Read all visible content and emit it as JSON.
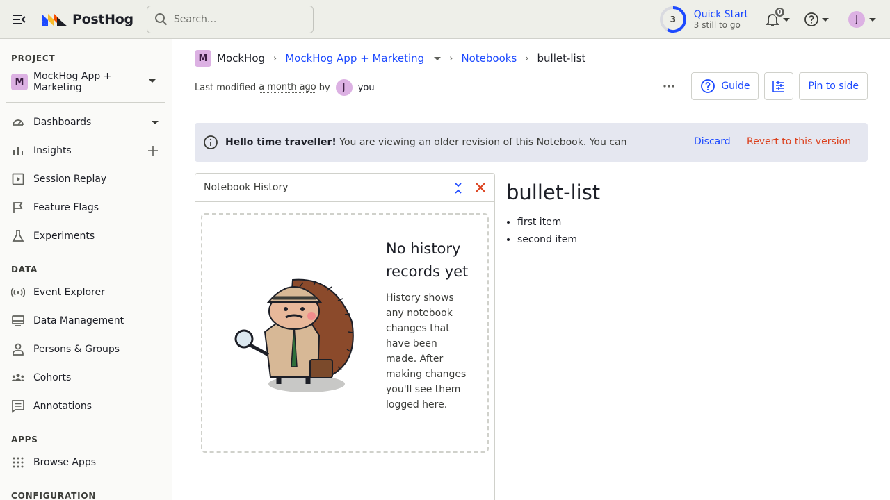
{
  "topbar": {
    "logo_text": "PostHog",
    "search_placeholder": "Search...",
    "quick_start": {
      "count": "3",
      "title": "Quick Start",
      "subtitle": "3 still to go"
    },
    "notifications_count": "0",
    "user_initial": "J"
  },
  "sidebar": {
    "project_label": "PROJECT",
    "project_badge": "M",
    "project_name": "MockHog App + Marketing",
    "items_project": [
      {
        "label": "Dashboards",
        "icon": "gauge-icon"
      },
      {
        "label": "Insights",
        "icon": "bar-chart-icon"
      },
      {
        "label": "Session Replay",
        "icon": "play-square-icon"
      },
      {
        "label": "Feature Flags",
        "icon": "flag-icon"
      },
      {
        "label": "Experiments",
        "icon": "flask-icon"
      }
    ],
    "data_label": "DATA",
    "items_data": [
      {
        "label": "Event Explorer",
        "icon": "broadcast-icon"
      },
      {
        "label": "Data Management",
        "icon": "database-icon"
      },
      {
        "label": "Persons & Groups",
        "icon": "person-icon"
      },
      {
        "label": "Cohorts",
        "icon": "people-icon"
      },
      {
        "label": "Annotations",
        "icon": "comment-icon"
      }
    ],
    "apps_label": "APPS",
    "items_apps": [
      {
        "label": "Browse Apps",
        "icon": "grid-dots-icon"
      }
    ],
    "config_label": "CONFIGURATION"
  },
  "breadcrumb": {
    "org_badge": "M",
    "org": "MockHog",
    "project": "MockHog App + Marketing",
    "section": "Notebooks",
    "current": "bullet-list"
  },
  "meta": {
    "prefix": "Last modified",
    "ago": "a month ago",
    "by": "by",
    "user_initial": "J",
    "user": "you"
  },
  "actions": {
    "guide": "Guide",
    "pin": "Pin to side"
  },
  "banner": {
    "bold": "Hello time traveller!",
    "text": " You are viewing an older revision of this Notebook. You can",
    "discard": "Discard",
    "revert": "Revert to this version"
  },
  "history": {
    "title": "Notebook History",
    "empty_title": "No history records yet",
    "empty_body": "History shows any notebook changes that have been made. After making changes you'll see them logged here."
  },
  "notebook": {
    "title": "bullet-list",
    "items": [
      "first item",
      "second item"
    ]
  },
  "colors": {
    "accent": "#1d4aff",
    "danger": "#db3f1b",
    "avatar": "#dcb1e3"
  }
}
